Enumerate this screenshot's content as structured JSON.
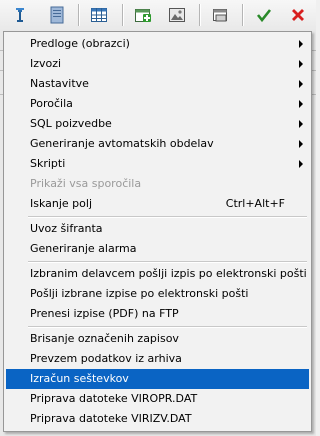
{
  "toolbar": {
    "buttons": [
      {
        "icon": "key-icon"
      },
      {
        "icon": "document-icon"
      },
      {
        "icon": "table-grid-icon"
      },
      {
        "icon": "add-record-icon"
      },
      {
        "icon": "image-icon"
      },
      {
        "icon": "print-preview-icon"
      },
      {
        "icon": "confirm-check-icon"
      },
      {
        "icon": "cancel-x-icon"
      }
    ]
  },
  "menu": {
    "items": [
      {
        "label": "Predloge (obrazci)",
        "submenu": true
      },
      {
        "label": "Izvozi",
        "submenu": true
      },
      {
        "label": "Nastavitve",
        "submenu": true
      },
      {
        "label": "Poročila",
        "submenu": true
      },
      {
        "label": "SQL poizvedbe",
        "submenu": true
      },
      {
        "label": "Generiranje avtomatskih obdelav",
        "submenu": true
      },
      {
        "label": "Skripti",
        "submenu": true
      },
      {
        "label": "Prikaži vsa sporočila",
        "disabled": true
      },
      {
        "label": "Iskanje polj",
        "shortcut": "Ctrl+Alt+F"
      },
      {
        "label": "Uvoz šifranta"
      },
      {
        "label": "Generiranje alarma"
      },
      {
        "label": "Izbranim delavcem pošlji izpis po elektronski pošti"
      },
      {
        "label": "Pošlji izbrane izpise po elektronski pošti"
      },
      {
        "label": "Prenesi izpise (PDF) na FTP"
      },
      {
        "label": "Brisanje označenih zapisov"
      },
      {
        "label": "Prevzem podatkov iz arhiva"
      },
      {
        "label": "Izračun seštevkov",
        "selected": true
      },
      {
        "label": "Priprava datoteke VIROPR.DAT"
      },
      {
        "label": "Priprava datoteke VIRIZV.DAT"
      }
    ]
  },
  "colors": {
    "selection": "#0a64c4",
    "confirm": "#2a8a2a",
    "cancel": "#d81e1e"
  }
}
